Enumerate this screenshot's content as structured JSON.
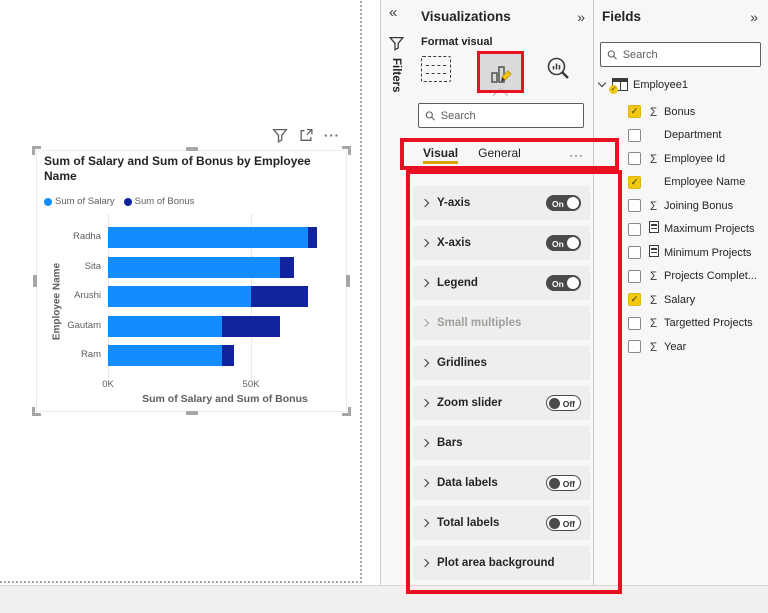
{
  "chart_data": {
    "type": "bar",
    "orientation": "horizontal-stacked",
    "title": "Sum of Salary and Sum of Bonus by Employee Name",
    "categories": [
      "Radha",
      "Sita",
      "Arushi",
      "Gautam",
      "Ram"
    ],
    "series": [
      {
        "name": "Sum of Salary",
        "color": "#118DFF",
        "values": [
          70000,
          60000,
          50000,
          40000,
          40000
        ]
      },
      {
        "name": "Sum of Bonus",
        "color": "#12239E",
        "values": [
          3000,
          5000,
          20000,
          20000,
          4000
        ]
      }
    ],
    "xlabel": "Sum of Salary and Sum of Bonus",
    "ylabel": "Employee Name",
    "x_ticks": [
      {
        "label": "0K",
        "value": 0
      },
      {
        "label": "50K",
        "value": 50000
      }
    ],
    "xlim": [
      0,
      84000
    ],
    "legend_position": "top",
    "gridlines": true
  },
  "visual_toolbar": {
    "filter_icon": "filter-funnel",
    "focus_icon": "focus-mode",
    "more_label": "···"
  },
  "filters_bar": {
    "collapse_icon": "«",
    "label": "Filters"
  },
  "visualizations": {
    "title": "Visualizations",
    "collapse_icon": "»",
    "subtitle": "Format visual",
    "icons": [
      {
        "name": "build-visual",
        "selected": false
      },
      {
        "name": "format-visual",
        "selected": true
      },
      {
        "name": "analytics",
        "selected": false
      }
    ],
    "search_placeholder": "Search",
    "tabs": [
      {
        "label": "Visual",
        "selected": true
      },
      {
        "label": "General",
        "selected": false
      }
    ],
    "tabs_more": "···",
    "sections": [
      {
        "label": "Y-axis",
        "toggle": "On"
      },
      {
        "label": "X-axis",
        "toggle": "On"
      },
      {
        "label": "Legend",
        "toggle": "On"
      },
      {
        "label": "Small multiples",
        "toggle": null,
        "disabled": true
      },
      {
        "label": "Gridlines",
        "toggle": null
      },
      {
        "label": "Zoom slider",
        "toggle": "Off"
      },
      {
        "label": "Bars",
        "toggle": null
      },
      {
        "label": "Data labels",
        "toggle": "Off"
      },
      {
        "label": "Total labels",
        "toggle": "Off"
      },
      {
        "label": "Plot area background",
        "toggle": null
      }
    ]
  },
  "fields": {
    "title": "Fields",
    "collapse_icon": "»",
    "search_placeholder": "Search",
    "table": {
      "name": "Employee1",
      "expanded": true
    },
    "items": [
      {
        "label": "Bonus",
        "checked": true,
        "icon": "sigma"
      },
      {
        "label": "Department",
        "checked": false,
        "icon": "none"
      },
      {
        "label": "Employee Id",
        "checked": false,
        "icon": "sigma"
      },
      {
        "label": "Employee Name",
        "checked": true,
        "icon": "none"
      },
      {
        "label": "Joining Bonus",
        "checked": false,
        "icon": "sigma"
      },
      {
        "label": "Maximum Projects",
        "checked": false,
        "icon": "calculator"
      },
      {
        "label": "Minimum Projects",
        "checked": false,
        "icon": "calculator"
      },
      {
        "label": "Projects Complet...",
        "checked": false,
        "icon": "sigma"
      },
      {
        "label": "Salary",
        "checked": true,
        "icon": "sigma"
      },
      {
        "label": "Targetted Projects",
        "checked": false,
        "icon": "sigma"
      },
      {
        "label": "Year",
        "checked": false,
        "icon": "sigma"
      }
    ]
  },
  "colors": {
    "annotation_red": "#E81123",
    "salary_blue": "#118DFF",
    "bonus_navy": "#12239E",
    "checkbox_yellow": "#F2C811",
    "tab_underline_gold": "#D8A200"
  }
}
